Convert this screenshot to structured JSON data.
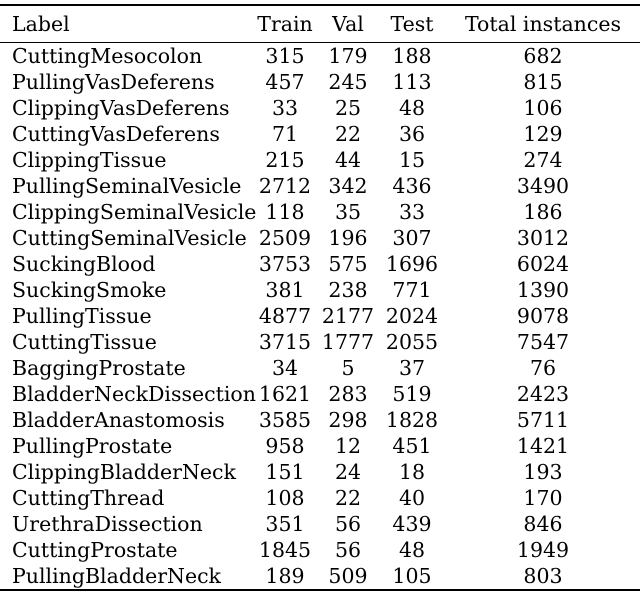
{
  "table": {
    "columns": [
      {
        "key": "label",
        "header": "Label"
      },
      {
        "key": "train",
        "header": "Train"
      },
      {
        "key": "val",
        "header": "Val"
      },
      {
        "key": "test",
        "header": "Test"
      },
      {
        "key": "total",
        "header": "Total instances"
      }
    ],
    "rows": [
      {
        "label": "CuttingMesocolon",
        "train": "315",
        "val": "179",
        "test": "188",
        "total": "682"
      },
      {
        "label": "PullingVasDeferens",
        "train": "457",
        "val": "245",
        "test": "113",
        "total": "815"
      },
      {
        "label": "ClippingVasDeferens",
        "train": "33",
        "val": "25",
        "test": "48",
        "total": "106"
      },
      {
        "label": "CuttingVasDeferens",
        "train": "71",
        "val": "22",
        "test": "36",
        "total": "129"
      },
      {
        "label": "ClippingTissue",
        "train": "215",
        "val": "44",
        "test": "15",
        "total": "274"
      },
      {
        "label": "PullingSeminalVesicle",
        "train": "2712",
        "val": "342",
        "test": "436",
        "total": "3490"
      },
      {
        "label": "ClippingSeminalVesicle",
        "train": "118",
        "val": "35",
        "test": "33",
        "total": "186"
      },
      {
        "label": "CuttingSeminalVesicle",
        "train": "2509",
        "val": "196",
        "test": "307",
        "total": "3012"
      },
      {
        "label": "SuckingBlood",
        "train": "3753",
        "val": "575",
        "test": "1696",
        "total": "6024"
      },
      {
        "label": "SuckingSmoke",
        "train": "381",
        "val": "238",
        "test": "771",
        "total": "1390"
      },
      {
        "label": "PullingTissue",
        "train": "4877",
        "val": "2177",
        "test": "2024",
        "total": "9078"
      },
      {
        "label": "CuttingTissue",
        "train": "3715",
        "val": "1777",
        "test": "2055",
        "total": "7547"
      },
      {
        "label": "BaggingProstate",
        "train": "34",
        "val": "5",
        "test": "37",
        "total": "76"
      },
      {
        "label": "BladderNeckDissection",
        "train": "1621",
        "val": "283",
        "test": "519",
        "total": "2423"
      },
      {
        "label": "BladderAnastomosis",
        "train": "3585",
        "val": "298",
        "test": "1828",
        "total": "5711"
      },
      {
        "label": "PullingProstate",
        "train": "958",
        "val": "12",
        "test": "451",
        "total": "1421"
      },
      {
        "label": "ClippingBladderNeck",
        "train": "151",
        "val": "24",
        "test": "18",
        "total": "193"
      },
      {
        "label": "CuttingThread",
        "train": "108",
        "val": "22",
        "test": "40",
        "total": "170"
      },
      {
        "label": "UrethraDissection",
        "train": "351",
        "val": "56",
        "test": "439",
        "total": "846"
      },
      {
        "label": "CuttingProstate",
        "train": "1845",
        "val": "56",
        "test": "48",
        "total": "1949"
      },
      {
        "label": "PullingBladderNeck",
        "train": "189",
        "val": "509",
        "test": "105",
        "total": "803"
      }
    ]
  },
  "style": {
    "rule_color": "#000000",
    "text_color": "#000000",
    "background": "#ffffff"
  }
}
